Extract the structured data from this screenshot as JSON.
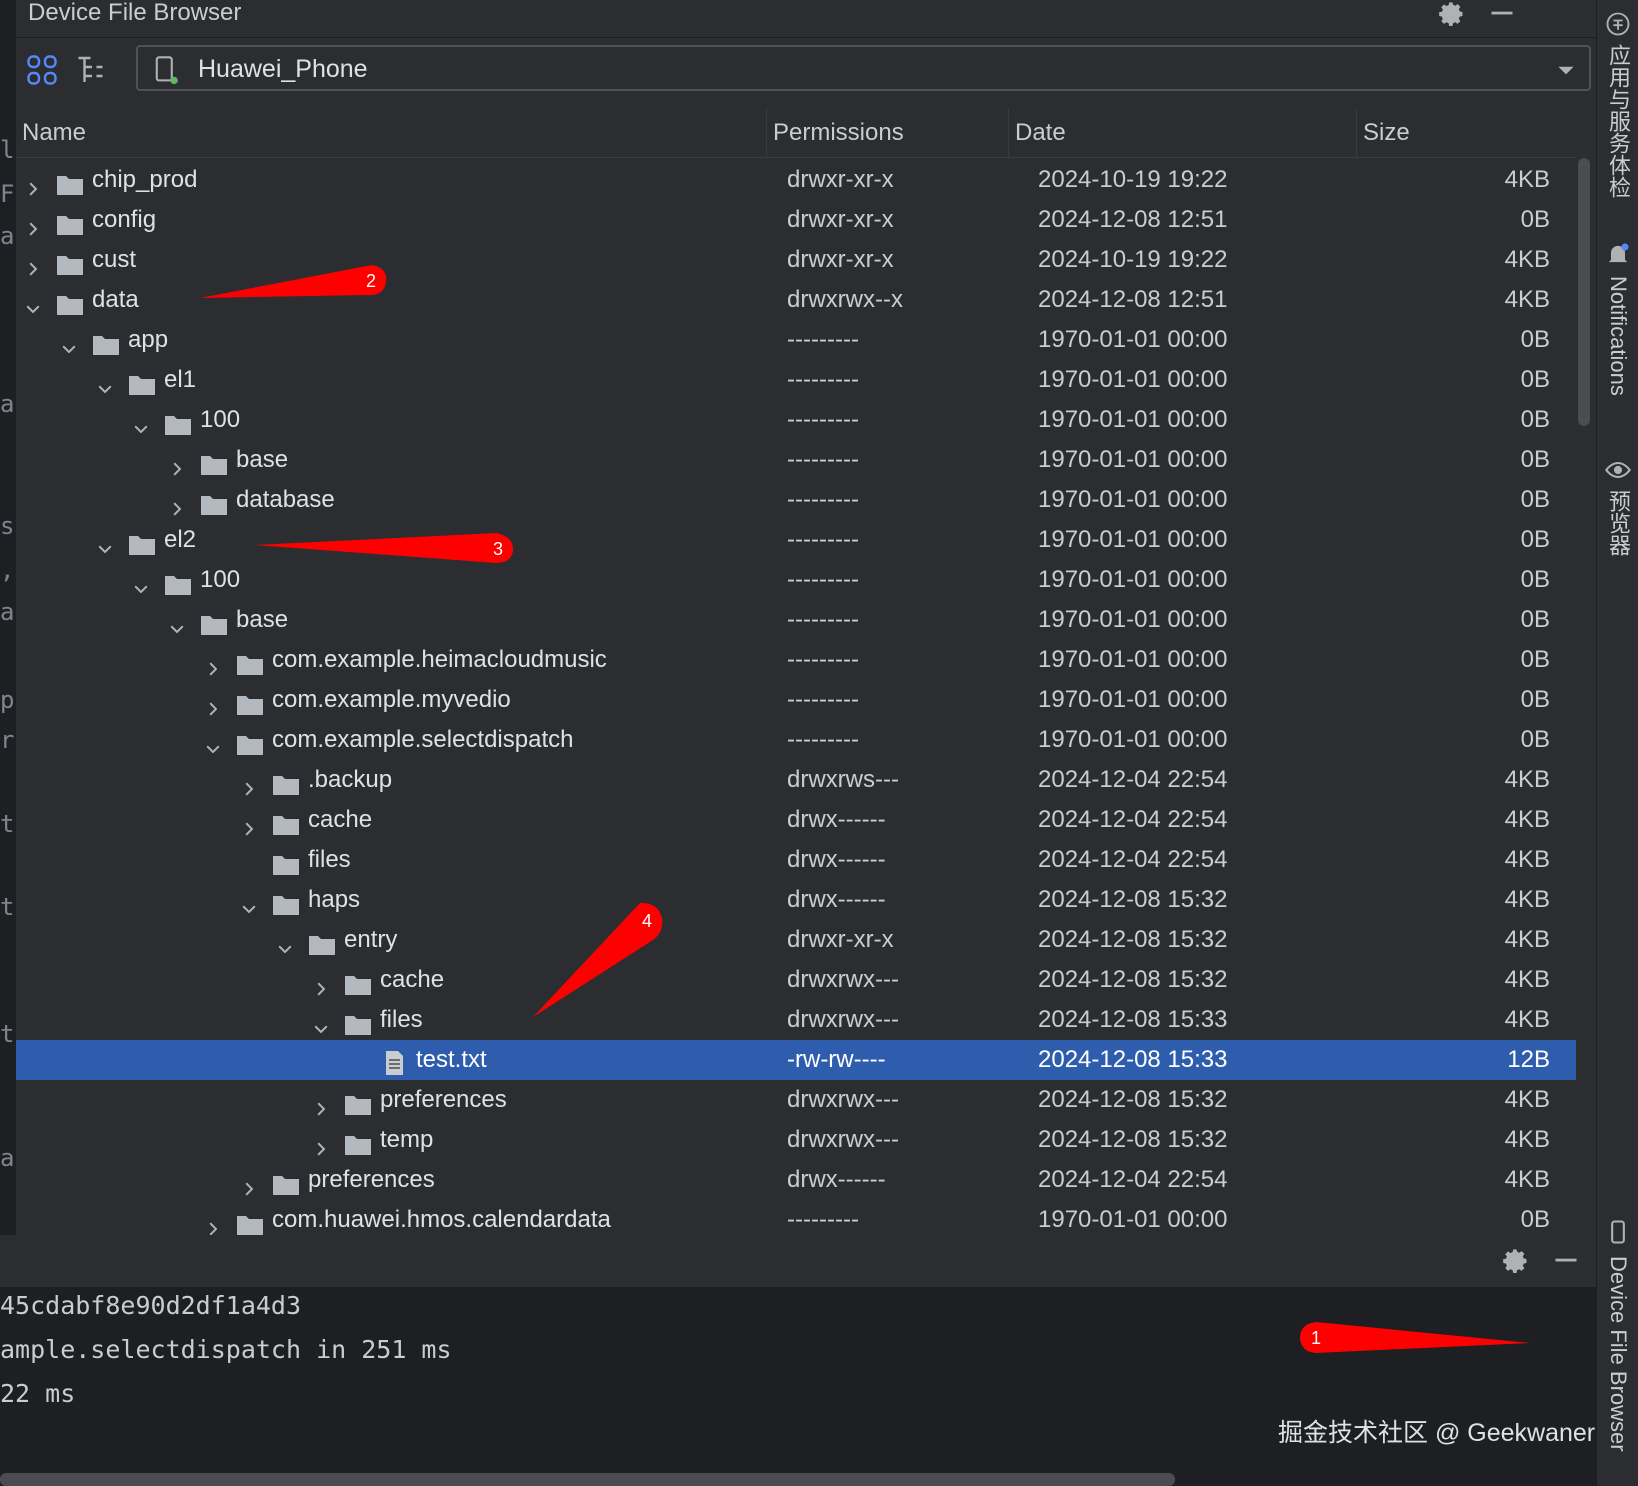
{
  "window": {
    "title": "Device File Browser"
  },
  "toolbar": {
    "device_name": "Huawei_Phone"
  },
  "table": {
    "columns": [
      "Name",
      "Permissions",
      "Date",
      "Size"
    ],
    "rows": [
      {
        "depth": 0,
        "chevron": "right",
        "icon": "folder",
        "name": "chip_prod",
        "perm": "drwxr-xr-x",
        "date": "2024-10-19 19:22",
        "size": "4KB"
      },
      {
        "depth": 0,
        "chevron": "right",
        "icon": "folder",
        "name": "config",
        "perm": "drwxr-xr-x",
        "date": "2024-12-08 12:51",
        "size": "0B"
      },
      {
        "depth": 0,
        "chevron": "right",
        "icon": "folder",
        "name": "cust",
        "perm": "drwxr-xr-x",
        "date": "2024-10-19 19:22",
        "size": "4KB"
      },
      {
        "depth": 0,
        "chevron": "down",
        "icon": "folder",
        "name": "data",
        "perm": "drwxrwx--x",
        "date": "2024-12-08 12:51",
        "size": "4KB"
      },
      {
        "depth": 1,
        "chevron": "down",
        "icon": "folder",
        "name": "app",
        "perm": "---------",
        "date": "1970-01-01 00:00",
        "size": "0B"
      },
      {
        "depth": 2,
        "chevron": "down",
        "icon": "folder",
        "name": "el1",
        "perm": "---------",
        "date": "1970-01-01 00:00",
        "size": "0B"
      },
      {
        "depth": 3,
        "chevron": "down",
        "icon": "folder",
        "name": "100",
        "perm": "---------",
        "date": "1970-01-01 00:00",
        "size": "0B"
      },
      {
        "depth": 4,
        "chevron": "right",
        "icon": "folder",
        "name": "base",
        "perm": "---------",
        "date": "1970-01-01 00:00",
        "size": "0B"
      },
      {
        "depth": 4,
        "chevron": "right",
        "icon": "folder",
        "name": "database",
        "perm": "---------",
        "date": "1970-01-01 00:00",
        "size": "0B"
      },
      {
        "depth": 2,
        "chevron": "down",
        "icon": "folder",
        "name": "el2",
        "perm": "---------",
        "date": "1970-01-01 00:00",
        "size": "0B"
      },
      {
        "depth": 3,
        "chevron": "down",
        "icon": "folder",
        "name": "100",
        "perm": "---------",
        "date": "1970-01-01 00:00",
        "size": "0B"
      },
      {
        "depth": 4,
        "chevron": "down",
        "icon": "folder",
        "name": "base",
        "perm": "---------",
        "date": "1970-01-01 00:00",
        "size": "0B"
      },
      {
        "depth": 5,
        "chevron": "right",
        "icon": "folder",
        "name": "com.example.heimacloudmusic",
        "perm": "---------",
        "date": "1970-01-01 00:00",
        "size": "0B"
      },
      {
        "depth": 5,
        "chevron": "right",
        "icon": "folder",
        "name": "com.example.myvedio",
        "perm": "---------",
        "date": "1970-01-01 00:00",
        "size": "0B"
      },
      {
        "depth": 5,
        "chevron": "down",
        "icon": "folder",
        "name": "com.example.selectdispatch",
        "perm": "---------",
        "date": "1970-01-01 00:00",
        "size": "0B"
      },
      {
        "depth": 6,
        "chevron": "right",
        "icon": "folder",
        "name": ".backup",
        "perm": "drwxrws---",
        "date": "2024-12-04 22:54",
        "size": "4KB"
      },
      {
        "depth": 6,
        "chevron": "right",
        "icon": "folder",
        "name": "cache",
        "perm": "drwx------",
        "date": "2024-12-04 22:54",
        "size": "4KB"
      },
      {
        "depth": 6,
        "chevron": "none",
        "icon": "folder",
        "name": "files",
        "perm": "drwx------",
        "date": "2024-12-04 22:54",
        "size": "4KB"
      },
      {
        "depth": 6,
        "chevron": "down",
        "icon": "folder",
        "name": "haps",
        "perm": "drwx------",
        "date": "2024-12-08 15:32",
        "size": "4KB"
      },
      {
        "depth": 7,
        "chevron": "down",
        "icon": "folder",
        "name": "entry",
        "perm": "drwxr-xr-x",
        "date": "2024-12-08 15:32",
        "size": "4KB"
      },
      {
        "depth": 8,
        "chevron": "right",
        "icon": "folder",
        "name": "cache",
        "perm": "drwxrwx---",
        "date": "2024-12-08 15:32",
        "size": "4KB"
      },
      {
        "depth": 8,
        "chevron": "down",
        "icon": "folder",
        "name": "files",
        "perm": "drwxrwx---",
        "date": "2024-12-08 15:33",
        "size": "4KB"
      },
      {
        "depth": 9,
        "chevron": "none",
        "icon": "file",
        "name": "test.txt",
        "perm": "-rw-rw----",
        "date": "2024-12-08 15:33",
        "size": "12B",
        "selected": true
      },
      {
        "depth": 8,
        "chevron": "right",
        "icon": "folder",
        "name": "preferences",
        "perm": "drwxrwx---",
        "date": "2024-12-08 15:32",
        "size": "4KB"
      },
      {
        "depth": 8,
        "chevron": "right",
        "icon": "folder",
        "name": "temp",
        "perm": "drwxrwx---",
        "date": "2024-12-08 15:32",
        "size": "4KB"
      },
      {
        "depth": 6,
        "chevron": "right",
        "icon": "folder",
        "name": "preferences",
        "perm": "drwx------",
        "date": "2024-12-04 22:54",
        "size": "4KB"
      },
      {
        "depth": 5,
        "chevron": "right",
        "icon": "folder",
        "name": "com.huawei.hmos.calendardata",
        "perm": "---------",
        "date": "1970-01-01 00:00",
        "size": "0B"
      }
    ]
  },
  "right_strip": {
    "app_services": "应用与服务体检",
    "notifications": "Notifications",
    "previewer": "预览器",
    "device_file_browser": "Device File Browser"
  },
  "log": {
    "lines": [
      "45cdabf8e90d2df1a4d3",
      "ample.selectdispatch in 251 ms",
      "22 ms"
    ]
  },
  "editor_fragments": [
    "l",
    "F",
    "a",
    "a",
    "st",
    ",",
    "a",
    "p",
    "r",
    "t",
    "t",
    "t",
    "ac"
  ],
  "watermark": "掘金技术社区 @ Geekwaner",
  "annotations": [
    {
      "label": "1"
    },
    {
      "label": "2"
    },
    {
      "label": "3"
    },
    {
      "label": "4"
    }
  ],
  "colors": {
    "background": "#2b2d30",
    "selection": "#2e5dad",
    "annotation": "#ff0000",
    "folder_icon": "#b4b8bf"
  },
  "icons": {
    "settings": "gear-icon",
    "minimize": "minimize-icon",
    "device": "phone-icon",
    "dropdown": "chevron-down-icon"
  }
}
